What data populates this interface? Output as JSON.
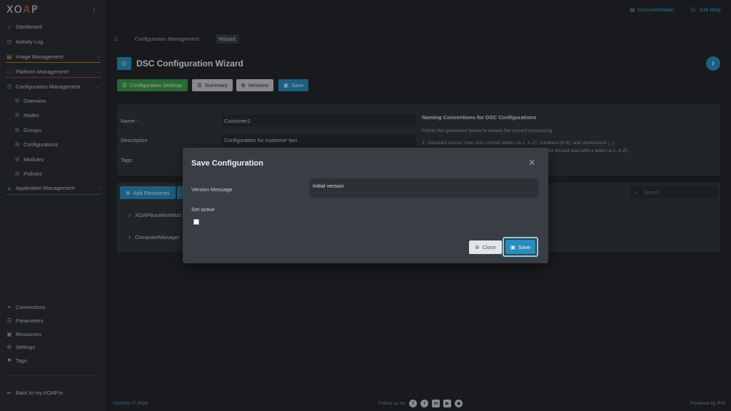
{
  "app": {
    "logo_prefix": "XO",
    "logo_accent": "A",
    "logo_suffix": "P",
    "brand_color": "#e8623a",
    "accent_color": "#2a8cbd"
  },
  "sidebar": {
    "items": [
      {
        "label": "Dashboard",
        "icon": "home-icon"
      },
      {
        "label": "Activity Log",
        "icon": "clock-icon"
      },
      {
        "label": "Image Management",
        "icon": "image-icon"
      },
      {
        "label": "Platform Management",
        "icon": "server-icon"
      },
      {
        "label": "Configuration Management",
        "icon": "config-icon"
      },
      {
        "label": "Overview",
        "icon": "grid-icon"
      },
      {
        "label": "Nodes",
        "icon": "grid-icon"
      },
      {
        "label": "Groups",
        "icon": "grid-icon"
      },
      {
        "label": "Configurations",
        "icon": "grid-icon"
      },
      {
        "label": "Modules",
        "icon": "grid-icon"
      },
      {
        "label": "Policies",
        "icon": "grid-icon"
      },
      {
        "label": "Application Management",
        "icon": "app-icon"
      }
    ],
    "bottom_items": [
      {
        "label": "Connections",
        "icon": "link-icon"
      },
      {
        "label": "Parameters",
        "icon": "list-icon"
      },
      {
        "label": "Resources",
        "icon": "box-icon"
      },
      {
        "label": "Settings",
        "icon": "gear-icon"
      },
      {
        "label": "Tags",
        "icon": "bookmark-icon"
      }
    ],
    "back_link": "Back to my.XOAP.io"
  },
  "topbar": {
    "documentation": "Documentation",
    "get_help": "Get Help"
  },
  "breadcrumb": {
    "items": [
      "Configuration Management",
      "Wizard"
    ]
  },
  "page": {
    "title": "DSC Configuration Wizard",
    "tabs": [
      "Configuration Settings",
      "Summary",
      "Versions",
      "Save"
    ]
  },
  "form": {
    "name_label": "Name",
    "name_required": "*",
    "name_value": "Customer2",
    "description_label": "Description",
    "description_value": "Configuration for customer two",
    "tags_label": "Tags"
  },
  "naming": {
    "title": "Naming Conventions for DSC Configurations",
    "intro": "Follow the guidelines below to ensure the correct processing:",
    "rule1": "1. Standard names may only contain letters (a-z, A-Z), numbers (0-9), and underscore (_).",
    "rule2": "with hyphen (-), and should start with a letter (a-z, A-Z)."
  },
  "resources": {
    "add_label": "Add Resources",
    "search_placeholder": "Search",
    "tree": [
      "XOAPBaselineMod",
      "ComputerManager"
    ]
  },
  "modal": {
    "title": "Save Configuration",
    "version_label": "Version Message",
    "version_value": "Initial version",
    "set_active_label": "Set active",
    "set_active_checked": false,
    "close_label": "Close",
    "save_label": "Save"
  },
  "footer": {
    "brand": "XOAP.io",
    "copyright": "© 2024",
    "follow": "Follow us on",
    "powered": "Powered by RIS"
  }
}
